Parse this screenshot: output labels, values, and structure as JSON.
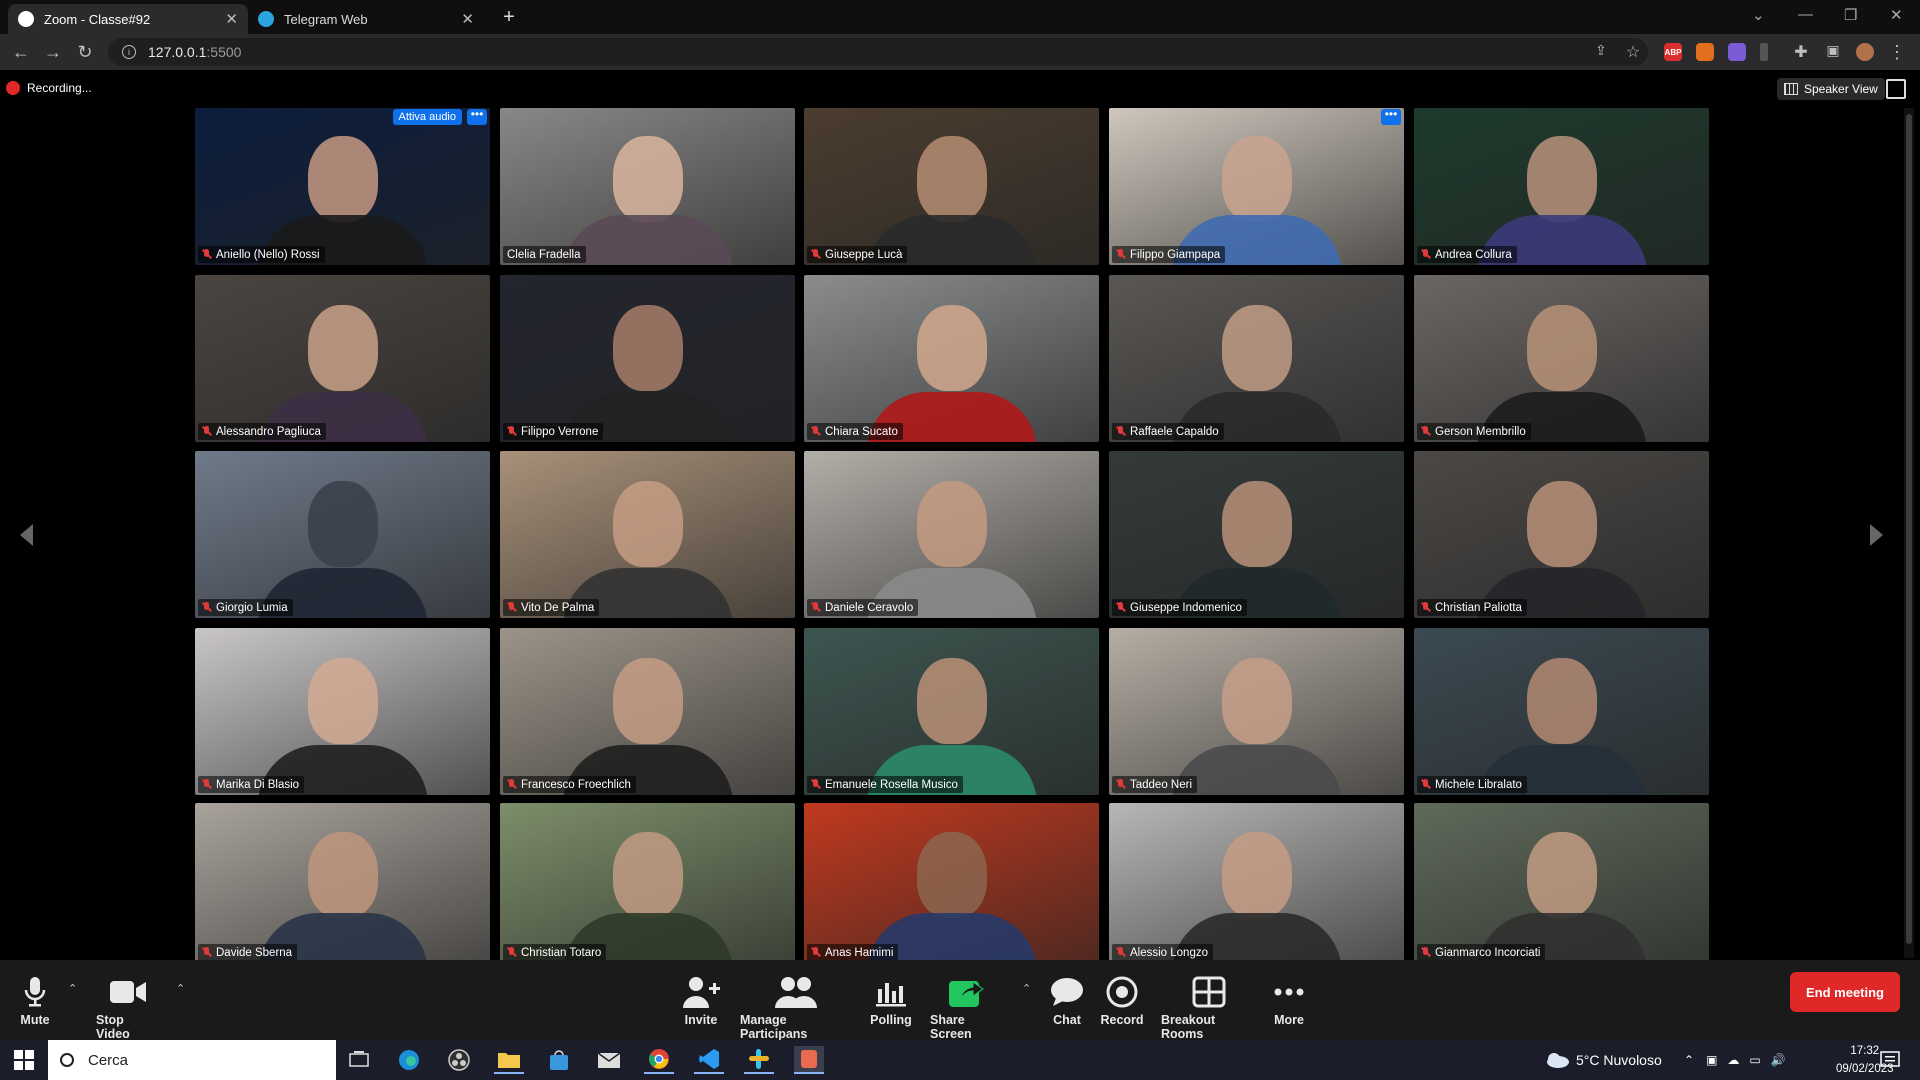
{
  "browser": {
    "tabs": [
      {
        "label": "Zoom - Classe#92",
        "active": true,
        "icon": "zoom-icon"
      },
      {
        "label": "Telegram Web",
        "active": false,
        "icon": "telegram-icon"
      }
    ],
    "url_host": "127.0.0.1",
    "url_port": ":5500",
    "extensions": [
      "ABP",
      "fox",
      "pen",
      "puzzle"
    ]
  },
  "meeting": {
    "recording_label": "Recording...",
    "speaker_view_label": "Speaker View",
    "attiva_audio_label": "Attiva audio",
    "participants": [
      {
        "name": "Aniello (Nello) Rossi",
        "muted": true,
        "bg": "#0c1d3d",
        "skin": "#c79a84",
        "shirt": "#1a1a1a"
      },
      {
        "name": "Clelia Fradella",
        "muted": false,
        "bg": "#8a8886",
        "skin": "#d8b59e",
        "shirt": "#5a4a55"
      },
      {
        "name": "Giuseppe Lucà",
        "muted": true,
        "bg": "#4b3d2f",
        "skin": "#b58d72",
        "shirt": "#2a2a2a"
      },
      {
        "name": "Filippo Giampapa",
        "muted": true,
        "bg": "#cfc7bd",
        "skin": "#c9a48e",
        "shirt": "#3f6ab1"
      },
      {
        "name": "Andrea Collura",
        "muted": true,
        "bg": "#1e3a2c",
        "skin": "#b8927d",
        "shirt": "#3b3a7a"
      },
      {
        "name": "Alessandro Pagliuca",
        "muted": true,
        "bg": "#4a4540",
        "skin": "#c9a189",
        "shirt": "#3d2f45"
      },
      {
        "name": "Filippo Verrone",
        "muted": true,
        "bg": "#23252f",
        "skin": "#a77e68",
        "shirt": "#222"
      },
      {
        "name": "Chiara Sucato",
        "muted": true,
        "bg": "#8a8c8e",
        "skin": "#d3a88c",
        "shirt": "#b01818"
      },
      {
        "name": "Raffaele Capaldo",
        "muted": true,
        "bg": "#5a5754",
        "skin": "#c19c86",
        "shirt": "#2a2a2a"
      },
      {
        "name": "Gerson Membrillo",
        "muted": true,
        "bg": "#6a6663",
        "skin": "#b99278",
        "shirt": "#1c1c1c"
      },
      {
        "name": "Giorgio Lumia",
        "muted": true,
        "bg": "#6f7a8a",
        "skin": "#3a3f4a",
        "shirt": "#1f2633"
      },
      {
        "name": "Vito De Palma",
        "muted": true,
        "bg": "#a89179",
        "skin": "#c59c82",
        "shirt": "#333"
      },
      {
        "name": "Daniele Ceravolo",
        "muted": true,
        "bg": "#b2aea8",
        "skin": "#c49a80",
        "shirt": "#8a8a8a"
      },
      {
        "name": "Giuseppe Indomenico",
        "muted": true,
        "bg": "#343a3a",
        "skin": "#b99179",
        "shirt": "#1f2a2a"
      },
      {
        "name": "Christian Paliotta",
        "muted": true,
        "bg": "#4b4845",
        "skin": "#b89179",
        "shirt": "#26262a"
      },
      {
        "name": "Marika Di Blasio",
        "muted": true,
        "bg": "#c9c6c8",
        "skin": "#d2aa92",
        "shirt": "#202020"
      },
      {
        "name": "Francesco Froechlich",
        "muted": true,
        "bg": "#9c9489",
        "skin": "#c49c84",
        "shirt": "#1f1f1f"
      },
      {
        "name": "Emanuele Rosella Musico",
        "muted": true,
        "bg": "#3d5550",
        "skin": "#bb9077",
        "shirt": "#2b8a6a"
      },
      {
        "name": "Taddeo Neri",
        "muted": true,
        "bg": "#b5aea4",
        "skin": "#c79f87",
        "shirt": "#4a4a4c"
      },
      {
        "name": "Michele Libralato",
        "muted": true,
        "bg": "#3b4a52",
        "skin": "#b38a72",
        "shirt": "#26303a"
      },
      {
        "name": "Davide Sberna",
        "muted": true,
        "bg": "#a9a39c",
        "skin": "#bf957c",
        "shirt": "#293447"
      },
      {
        "name": "Christian Totaro",
        "muted": true,
        "bg": "#7c8e6a",
        "skin": "#c29a82",
        "shirt": "#2f3a2a"
      },
      {
        "name": "Anas Hamimi",
        "muted": true,
        "bg": "#c0391f",
        "skin": "#8c6650",
        "shirt": "#263a6a"
      },
      {
        "name": "Alessio Longzo",
        "muted": true,
        "bg": "#b9b7b5",
        "skin": "#c49c85",
        "shirt": "#2a2a2a"
      },
      {
        "name": "Gianmarco Incorciati",
        "muted": true,
        "bg": "#5f6a5a",
        "skin": "#c29b82",
        "shirt": "#303030"
      }
    ]
  },
  "toolbar": {
    "mute_label": "Mute",
    "stop_video_label": "Stop Video",
    "invite_label": "Invite",
    "manage_label": "Manage Participans",
    "polling_label": "Polling",
    "share_label": "Share Screen",
    "chat_label": "Chat",
    "record_label": "Record",
    "breakout_label": "Breakout Rooms",
    "more_label": "More",
    "end_label": "End meeting",
    "share_color": "#22c55e"
  },
  "taskbar": {
    "search_placeholder": "Cerca",
    "weather": "5°C  Nuvoloso",
    "time": "17:32",
    "date": "09/02/2023"
  }
}
